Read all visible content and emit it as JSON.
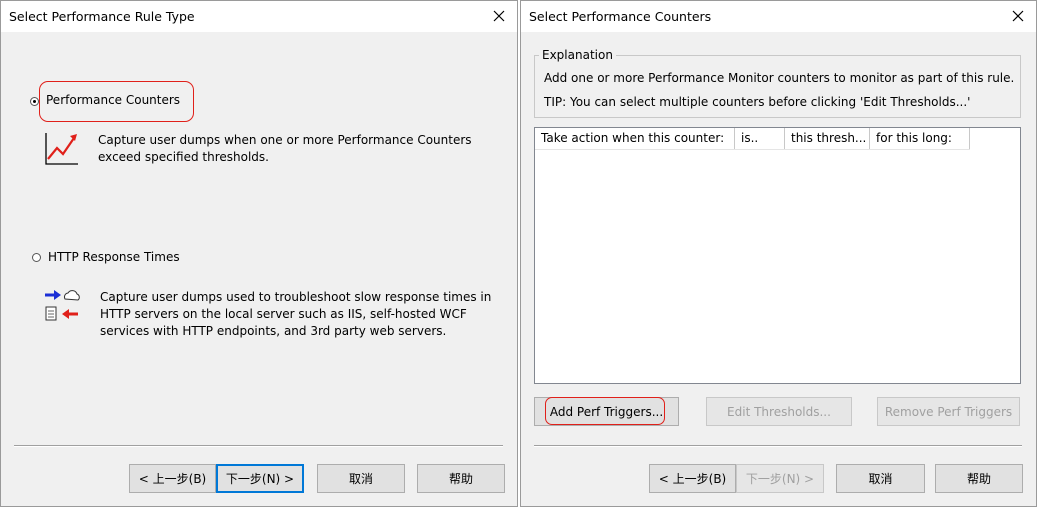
{
  "left_dialog": {
    "title": "Select Performance Rule Type",
    "options": [
      {
        "label": "Performance Counters",
        "selected": true,
        "description_lines": [
          "Capture user dumps when one or more Performance Counters",
          "exceed specified thresholds."
        ],
        "icon": "perf-chart-icon"
      },
      {
        "label": "HTTP Response Times",
        "selected": false,
        "description_lines": [
          "Capture user dumps used to troubleshoot slow response times in",
          "HTTP servers on the local server such as IIS, self-hosted WCF",
          "services with HTTP endpoints, and 3rd party web servers."
        ],
        "icon": "http-request-response-icon"
      }
    ],
    "buttons": {
      "back": "< 上一步(B)",
      "next": "下一步(N) >",
      "cancel": "取消",
      "help": "帮助"
    }
  },
  "right_dialog": {
    "title": "Select Performance Counters",
    "explanation": {
      "legend": "Explanation",
      "text": "Add one or more Performance Monitor counters to monitor as part of this rule.",
      "tip": "TIP:  You can select multiple counters before clicking 'Edit Thresholds...'"
    },
    "list": {
      "columns": [
        "Take action when this counter:",
        "is..",
        "this thresh...",
        "for this long:"
      ],
      "rows": []
    },
    "action_buttons": {
      "add": "Add Perf Triggers...",
      "edit": "Edit Thresholds...",
      "remove": "Remove Perf Triggers"
    },
    "buttons": {
      "back": "< 上一步(B)",
      "next": "下一步(N) >",
      "cancel": "取消",
      "help": "帮助"
    }
  },
  "colors": {
    "highlight": "#e0201a",
    "accent": "#0078d7",
    "arrow_blue": "#1b2fd6",
    "arrow_red": "#e0201a"
  }
}
